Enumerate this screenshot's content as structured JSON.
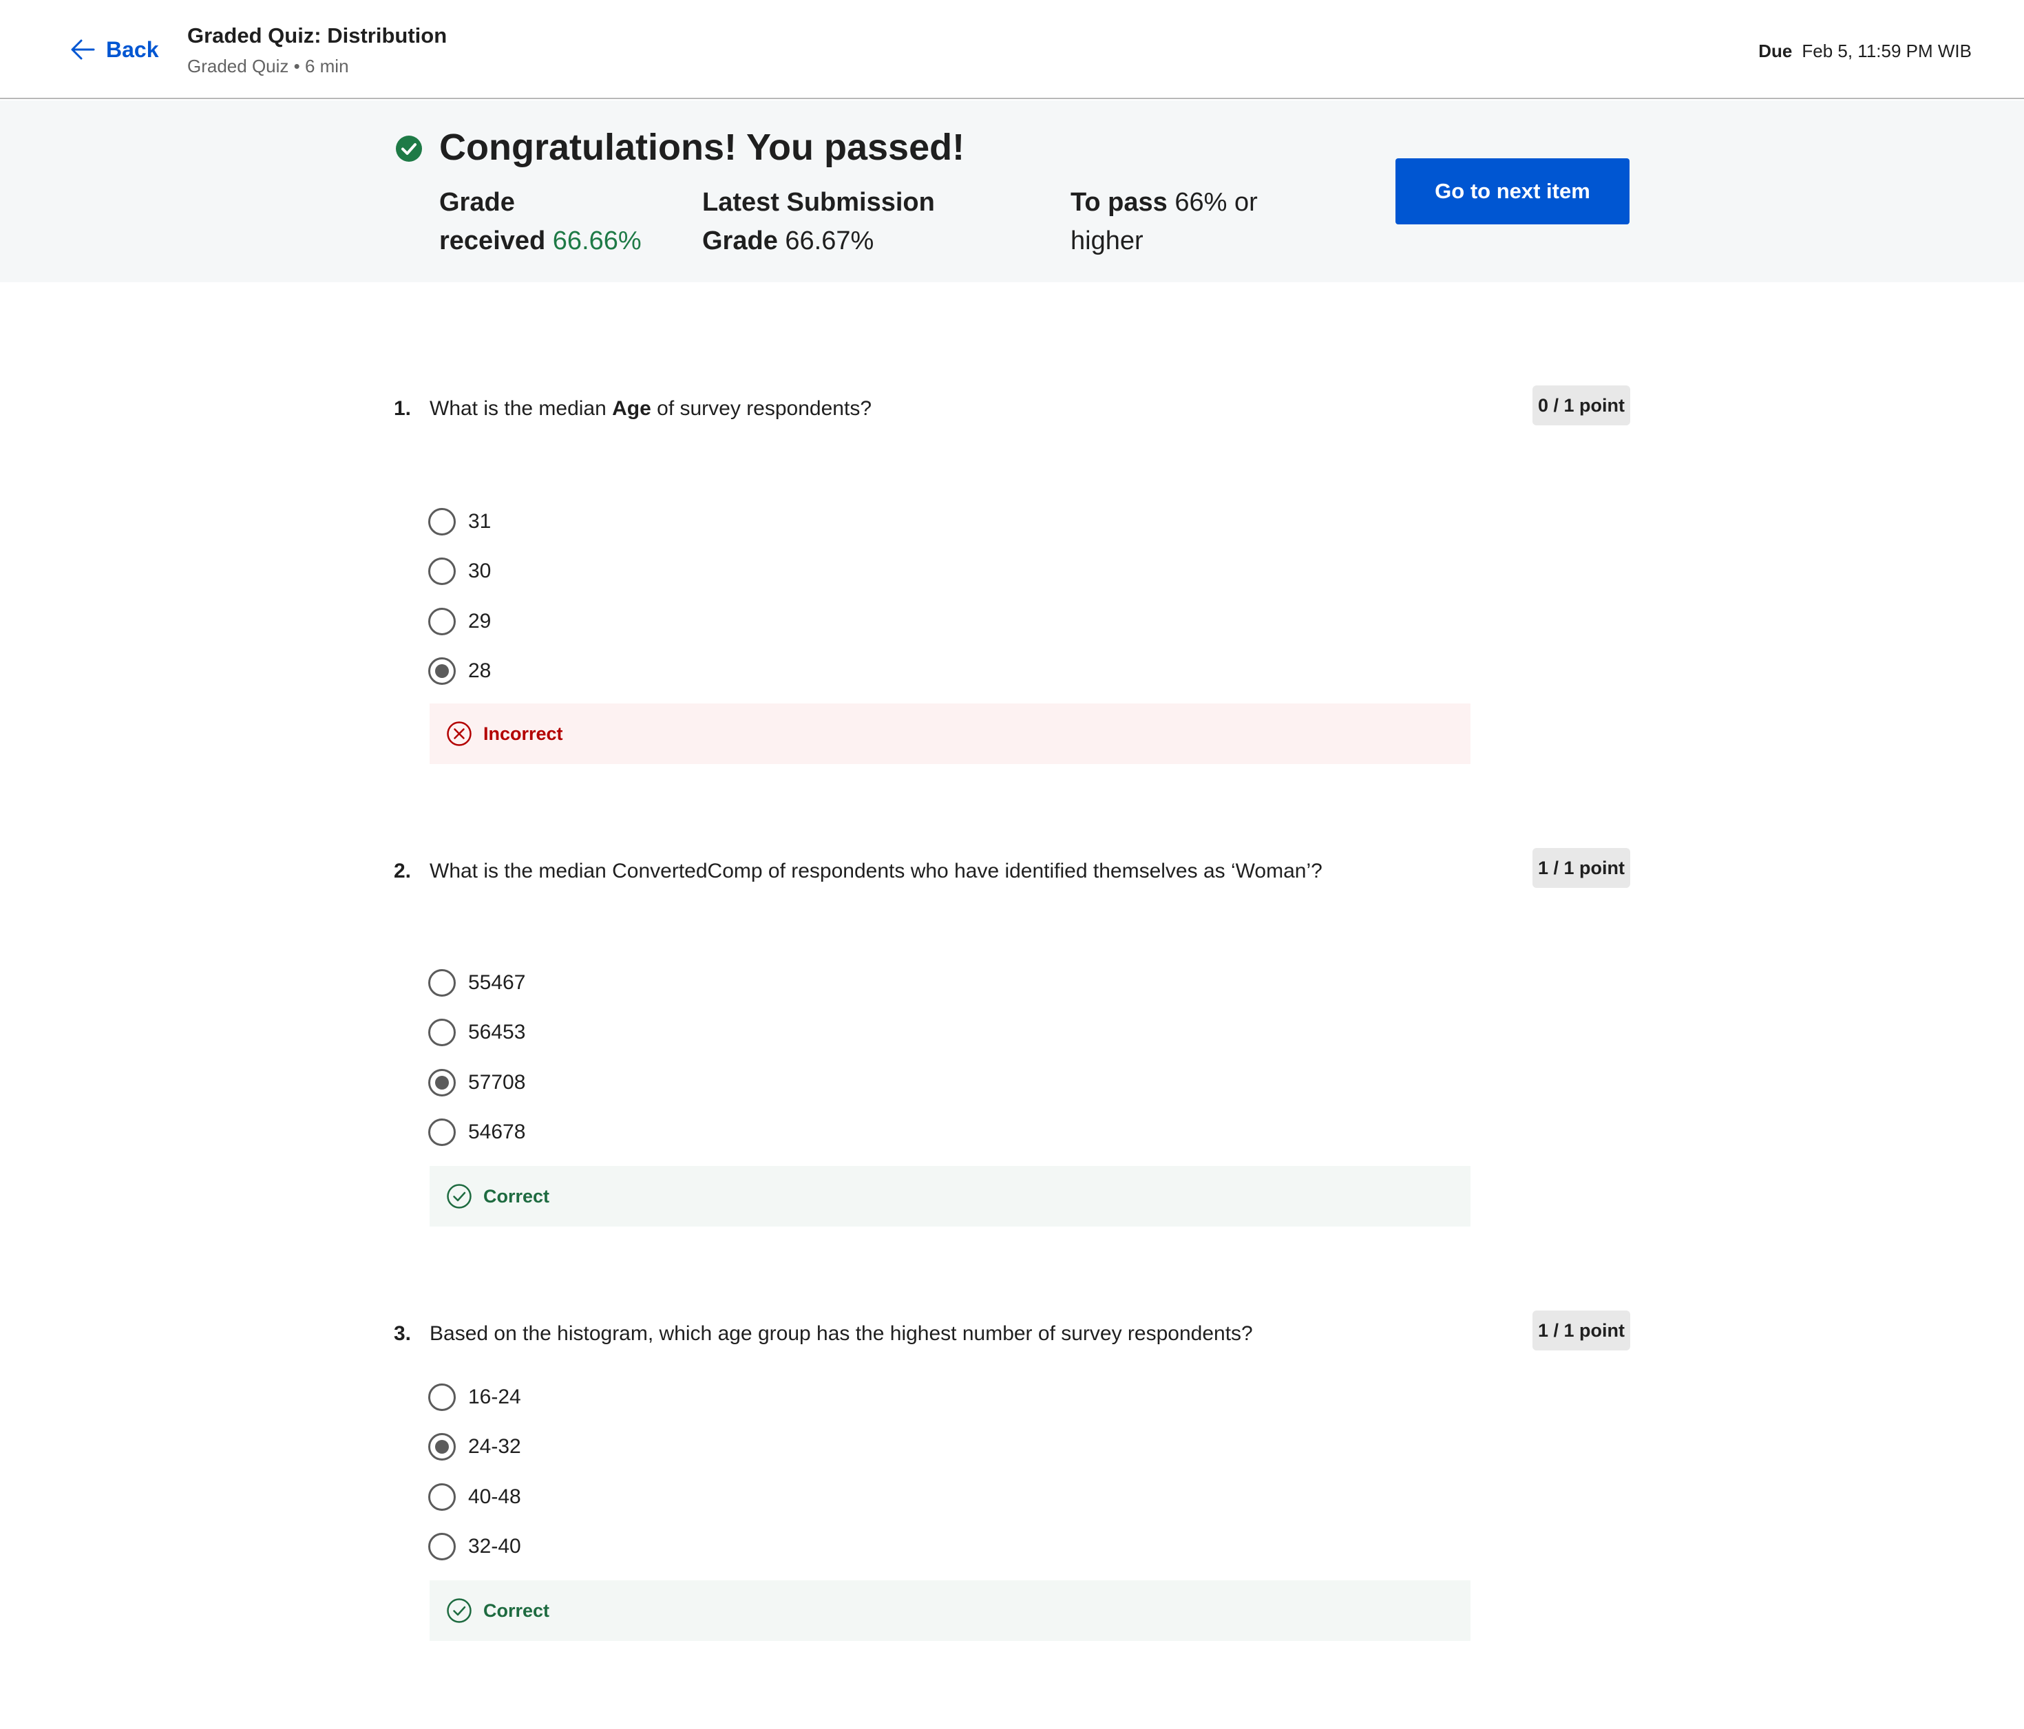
{
  "header": {
    "back_label": "Back",
    "title": "Graded Quiz: Distribution",
    "subtitle": "Graded Quiz • 6 min",
    "due_label": "Due",
    "due_value": "Feb 5, 11:59 PM WIB"
  },
  "result": {
    "heading": "Congratulations! You passed!",
    "grade_received_label_line1": "Grade",
    "grade_received_label_line2": "received",
    "grade_received_value": "66.66%",
    "latest_submission_label_line1": "Latest Submission",
    "latest_submission_label_line2": "Grade",
    "latest_submission_value": "66.67%",
    "to_pass_label": "To pass",
    "to_pass_value_line1": "66% or",
    "to_pass_value_line2": "higher",
    "next_button_label": "Go to next item",
    "colors": {
      "accent": "#0056d2",
      "success": "#1e7a46",
      "error": "#b30000"
    }
  },
  "questions": [
    {
      "number": "1.",
      "text_before": "What is the median ",
      "text_bold": "Age",
      "text_after": " of survey respondents?",
      "points": "0 / 1 point",
      "options": [
        "31",
        "30",
        "29",
        "28"
      ],
      "selected_index": 3,
      "feedback": "Incorrect",
      "feedback_status": "incorrect"
    },
    {
      "number": "2.",
      "text": "What is the median ConvertedComp of  respondents who have identified themselves as ‘Woman’?",
      "points": "1 / 1 point",
      "options": [
        "55467",
        "56453",
        "57708",
        "54678"
      ],
      "selected_index": 2,
      "feedback": "Correct",
      "feedback_status": "correct"
    },
    {
      "number": "3.",
      "text": "Based on the histogram, which age group has the highest number of survey respondents?",
      "points": "1 / 1 point",
      "options": [
        "16-24",
        "24-32",
        "40-48",
        "32-40"
      ],
      "selected_index": 1,
      "feedback": "Correct",
      "feedback_status": "correct"
    }
  ]
}
